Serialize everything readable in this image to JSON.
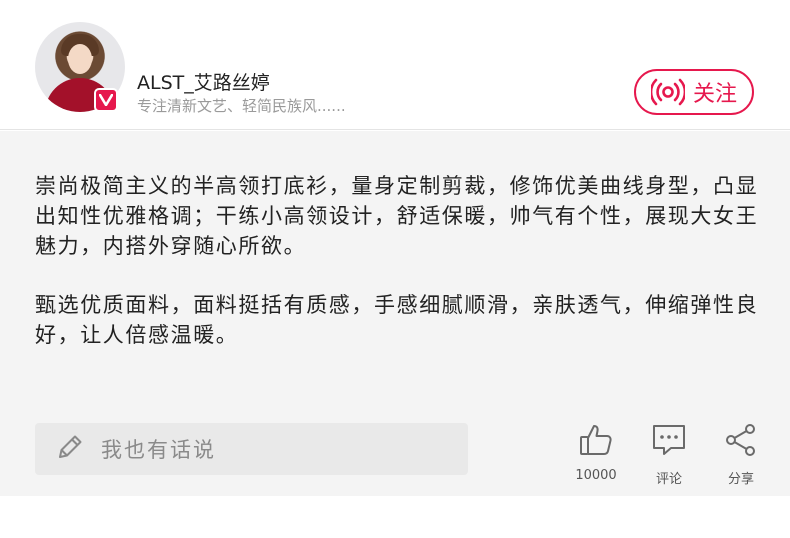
{
  "user": {
    "name": "ALST_艾路丝婷",
    "intro": "专注清新文艺、轻简民族风......"
  },
  "follow_label": "关注",
  "post": {
    "paragraphs": [
      "崇尚极简主义的半高领打底衫，量身定制剪裁，修饰优美曲线身型，凸显出知性优雅格调；干练小高领设计，舒适保暖，帅气有个性，展现大女王魅力，内搭外穿随心所欲。",
      "甄选优质面料，面料挺括有质感，手感细腻顺滑，亲肤透气，伸缩弹性良好，让人倍感温暖。"
    ]
  },
  "comment_input": {
    "placeholder": "我也有话说"
  },
  "actions": {
    "like_count": "10000",
    "comment_label": "评论",
    "share_label": "分享"
  },
  "colors": {
    "accent": "#e6184d",
    "content_bg": "#f4f4f4",
    "input_bg": "#e9e9e9"
  },
  "icons": [
    "v-badge-icon",
    "live-icon",
    "pencil-icon",
    "thumbs-up-icon",
    "comment-icon",
    "share-icon"
  ]
}
